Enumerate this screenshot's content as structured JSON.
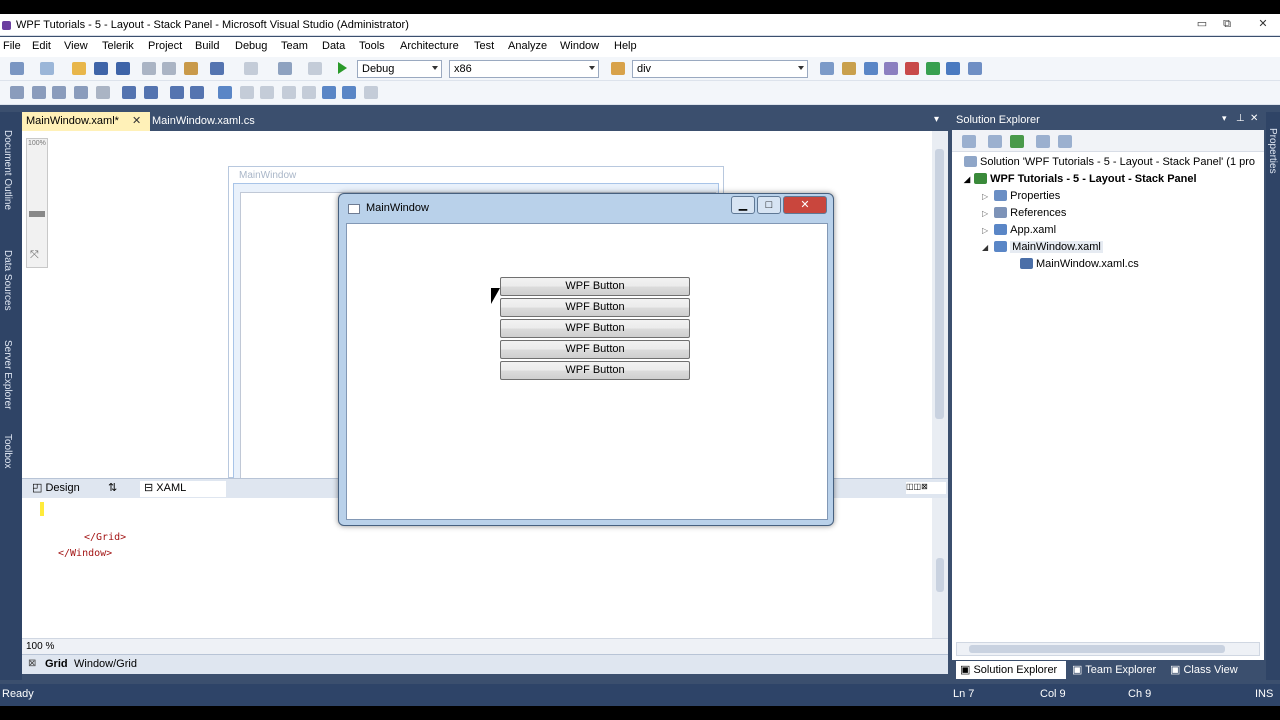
{
  "titlebar": {
    "title": "WPF Tutorials - 5 - Layout - Stack Panel - Microsoft Visual Studio (Administrator)"
  },
  "menu": [
    "File",
    "Edit",
    "View",
    "Telerik",
    "Project",
    "Build",
    "Debug",
    "Team",
    "Data",
    "Tools",
    "Architecture",
    "Test",
    "Analyze",
    "Window",
    "Help"
  ],
  "toolbar": {
    "config": "Debug",
    "platform": "x86",
    "find": "div"
  },
  "doctabs": [
    "MainWindow.xaml*",
    "MainWindow.xaml.cs"
  ],
  "left_tabs": [
    "Document Outline",
    "Data Sources",
    "Server Explorer",
    "Toolbox"
  ],
  "zoom_label": "100%",
  "designer": {
    "window_title": "MainWindow"
  },
  "view_tabs": {
    "design": "Design",
    "swap": "⇅",
    "xaml": "XAML"
  },
  "xaml_lines": {
    "line1": "</Grid>",
    "line2": "</Window>"
  },
  "xaml_zoom": "100 %",
  "pathbar": {
    "grid": "Grid",
    "path": "Window/Grid"
  },
  "solution_explorer": {
    "title": "Solution Explorer",
    "solution": "Solution 'WPF Tutorials - 5 - Layout - Stack Panel' (1 pro",
    "project": "WPF Tutorials - 5 - Layout - Stack Panel",
    "items": [
      "Properties",
      "References",
      "App.xaml",
      "MainWindow.xaml",
      "MainWindow.xaml.cs"
    ],
    "tabs": [
      "Solution Explorer",
      "Team Explorer",
      "Class View"
    ]
  },
  "running_window": {
    "title": "MainWindow",
    "buttons": [
      "WPF Button",
      "WPF Button",
      "WPF Button",
      "WPF Button",
      "WPF Button"
    ]
  },
  "status": {
    "ready": "Ready",
    "ln": "Ln 7",
    "col": "Col 9",
    "ch": "Ch 9",
    "ins": "INS"
  },
  "right_tab": "Properties"
}
